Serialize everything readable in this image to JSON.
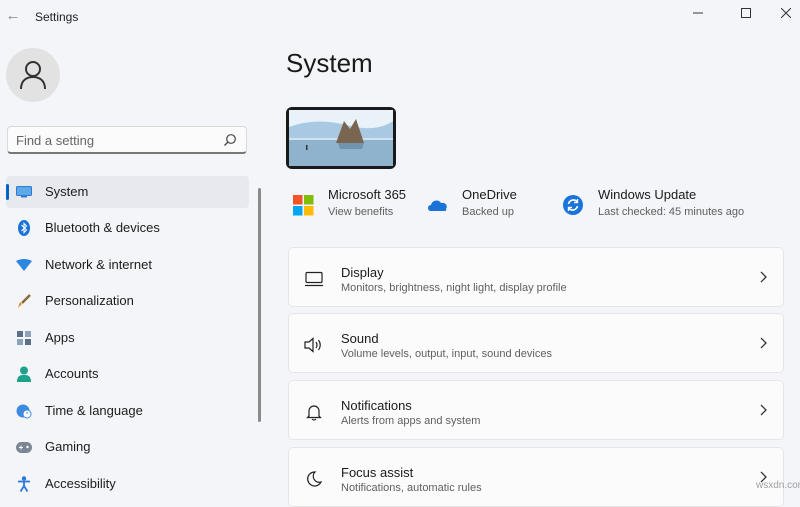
{
  "window": {
    "title": "Settings",
    "controls": [
      "minimize-icon",
      "maximize-icon",
      "close-icon"
    ]
  },
  "search": {
    "placeholder": "Find a setting"
  },
  "sidebar": {
    "items": [
      {
        "label": "System",
        "icon": "monitor-icon",
        "active": true
      },
      {
        "label": "Bluetooth & devices",
        "icon": "bluetooth-icon"
      },
      {
        "label": "Network & internet",
        "icon": "wifi-icon"
      },
      {
        "label": "Personalization",
        "icon": "brush-icon"
      },
      {
        "label": "Apps",
        "icon": "apps-icon"
      },
      {
        "label": "Accounts",
        "icon": "person-icon"
      },
      {
        "label": "Time & language",
        "icon": "globe-clock-icon"
      },
      {
        "label": "Gaming",
        "icon": "gamepad-icon"
      },
      {
        "label": "Accessibility",
        "icon": "accessibility-icon"
      }
    ]
  },
  "main": {
    "title": "System",
    "shortcuts": [
      {
        "title": "Microsoft 365",
        "subtitle": "View benefits",
        "icon": "microsoft-logo-icon"
      },
      {
        "title": "OneDrive",
        "subtitle": "Backed up",
        "icon": "cloud-icon"
      },
      {
        "title": "Windows Update",
        "subtitle": "Last checked: 45 minutes ago",
        "icon": "update-icon"
      }
    ],
    "cards": [
      {
        "title": "Display",
        "subtitle": "Monitors, brightness, night light, display profile",
        "icon": "display-icon"
      },
      {
        "title": "Sound",
        "subtitle": "Volume levels, output, input, sound devices",
        "icon": "speaker-icon"
      },
      {
        "title": "Notifications",
        "subtitle": "Alerts from apps and system",
        "icon": "bell-icon"
      },
      {
        "title": "Focus assist",
        "subtitle": "Notifications, automatic rules",
        "icon": "moon-icon"
      }
    ]
  },
  "watermark": "wsxdn.com",
  "colors": {
    "accent": "#0067c0",
    "background": "#f3f5f9",
    "card": "#fbfbfc"
  }
}
